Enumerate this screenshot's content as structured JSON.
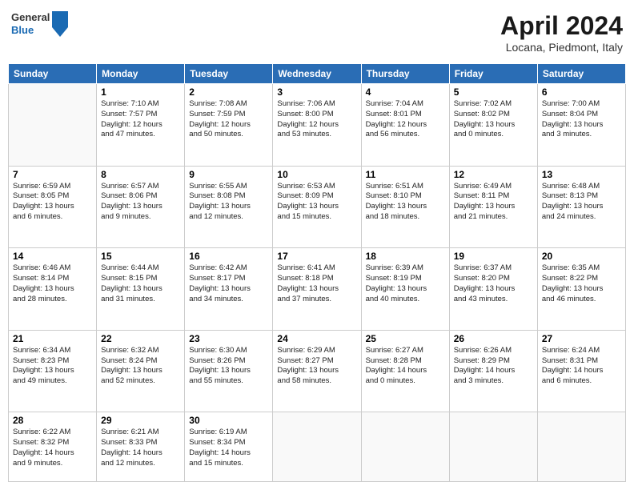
{
  "header": {
    "logo": {
      "line1": "General",
      "line2": "Blue"
    },
    "title": "April 2024",
    "location": "Locana, Piedmont, Italy"
  },
  "weekdays": [
    "Sunday",
    "Monday",
    "Tuesday",
    "Wednesday",
    "Thursday",
    "Friday",
    "Saturday"
  ],
  "weeks": [
    [
      {
        "day": "",
        "info": ""
      },
      {
        "day": "1",
        "info": "Sunrise: 7:10 AM\nSunset: 7:57 PM\nDaylight: 12 hours\nand 47 minutes."
      },
      {
        "day": "2",
        "info": "Sunrise: 7:08 AM\nSunset: 7:59 PM\nDaylight: 12 hours\nand 50 minutes."
      },
      {
        "day": "3",
        "info": "Sunrise: 7:06 AM\nSunset: 8:00 PM\nDaylight: 12 hours\nand 53 minutes."
      },
      {
        "day": "4",
        "info": "Sunrise: 7:04 AM\nSunset: 8:01 PM\nDaylight: 12 hours\nand 56 minutes."
      },
      {
        "day": "5",
        "info": "Sunrise: 7:02 AM\nSunset: 8:02 PM\nDaylight: 13 hours\nand 0 minutes."
      },
      {
        "day": "6",
        "info": "Sunrise: 7:00 AM\nSunset: 8:04 PM\nDaylight: 13 hours\nand 3 minutes."
      }
    ],
    [
      {
        "day": "7",
        "info": "Sunrise: 6:59 AM\nSunset: 8:05 PM\nDaylight: 13 hours\nand 6 minutes."
      },
      {
        "day": "8",
        "info": "Sunrise: 6:57 AM\nSunset: 8:06 PM\nDaylight: 13 hours\nand 9 minutes."
      },
      {
        "day": "9",
        "info": "Sunrise: 6:55 AM\nSunset: 8:08 PM\nDaylight: 13 hours\nand 12 minutes."
      },
      {
        "day": "10",
        "info": "Sunrise: 6:53 AM\nSunset: 8:09 PM\nDaylight: 13 hours\nand 15 minutes."
      },
      {
        "day": "11",
        "info": "Sunrise: 6:51 AM\nSunset: 8:10 PM\nDaylight: 13 hours\nand 18 minutes."
      },
      {
        "day": "12",
        "info": "Sunrise: 6:49 AM\nSunset: 8:11 PM\nDaylight: 13 hours\nand 21 minutes."
      },
      {
        "day": "13",
        "info": "Sunrise: 6:48 AM\nSunset: 8:13 PM\nDaylight: 13 hours\nand 24 minutes."
      }
    ],
    [
      {
        "day": "14",
        "info": "Sunrise: 6:46 AM\nSunset: 8:14 PM\nDaylight: 13 hours\nand 28 minutes."
      },
      {
        "day": "15",
        "info": "Sunrise: 6:44 AM\nSunset: 8:15 PM\nDaylight: 13 hours\nand 31 minutes."
      },
      {
        "day": "16",
        "info": "Sunrise: 6:42 AM\nSunset: 8:17 PM\nDaylight: 13 hours\nand 34 minutes."
      },
      {
        "day": "17",
        "info": "Sunrise: 6:41 AM\nSunset: 8:18 PM\nDaylight: 13 hours\nand 37 minutes."
      },
      {
        "day": "18",
        "info": "Sunrise: 6:39 AM\nSunset: 8:19 PM\nDaylight: 13 hours\nand 40 minutes."
      },
      {
        "day": "19",
        "info": "Sunrise: 6:37 AM\nSunset: 8:20 PM\nDaylight: 13 hours\nand 43 minutes."
      },
      {
        "day": "20",
        "info": "Sunrise: 6:35 AM\nSunset: 8:22 PM\nDaylight: 13 hours\nand 46 minutes."
      }
    ],
    [
      {
        "day": "21",
        "info": "Sunrise: 6:34 AM\nSunset: 8:23 PM\nDaylight: 13 hours\nand 49 minutes."
      },
      {
        "day": "22",
        "info": "Sunrise: 6:32 AM\nSunset: 8:24 PM\nDaylight: 13 hours\nand 52 minutes."
      },
      {
        "day": "23",
        "info": "Sunrise: 6:30 AM\nSunset: 8:26 PM\nDaylight: 13 hours\nand 55 minutes."
      },
      {
        "day": "24",
        "info": "Sunrise: 6:29 AM\nSunset: 8:27 PM\nDaylight: 13 hours\nand 58 minutes."
      },
      {
        "day": "25",
        "info": "Sunrise: 6:27 AM\nSunset: 8:28 PM\nDaylight: 14 hours\nand 0 minutes."
      },
      {
        "day": "26",
        "info": "Sunrise: 6:26 AM\nSunset: 8:29 PM\nDaylight: 14 hours\nand 3 minutes."
      },
      {
        "day": "27",
        "info": "Sunrise: 6:24 AM\nSunset: 8:31 PM\nDaylight: 14 hours\nand 6 minutes."
      }
    ],
    [
      {
        "day": "28",
        "info": "Sunrise: 6:22 AM\nSunset: 8:32 PM\nDaylight: 14 hours\nand 9 minutes."
      },
      {
        "day": "29",
        "info": "Sunrise: 6:21 AM\nSunset: 8:33 PM\nDaylight: 14 hours\nand 12 minutes."
      },
      {
        "day": "30",
        "info": "Sunrise: 6:19 AM\nSunset: 8:34 PM\nDaylight: 14 hours\nand 15 minutes."
      },
      {
        "day": "",
        "info": ""
      },
      {
        "day": "",
        "info": ""
      },
      {
        "day": "",
        "info": ""
      },
      {
        "day": "",
        "info": ""
      }
    ]
  ]
}
